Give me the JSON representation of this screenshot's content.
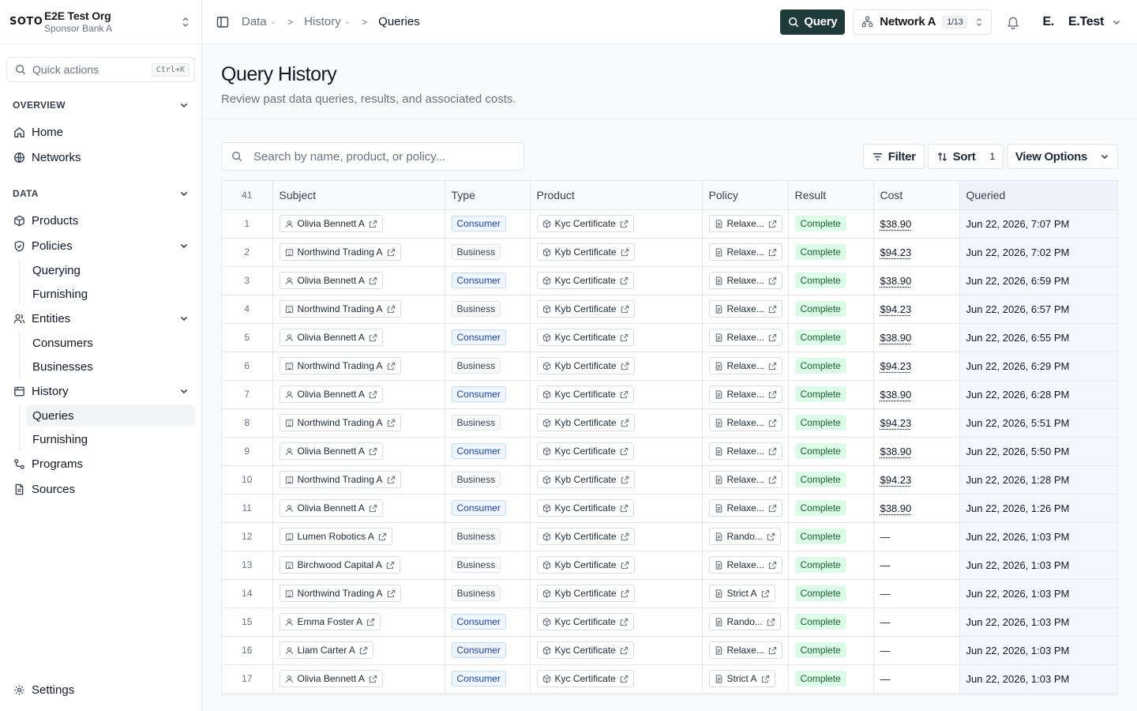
{
  "org": {
    "logo": "SOTO",
    "name": "E2E Test Org",
    "sub": "Sponsor Bank A"
  },
  "quick_actions": {
    "placeholder": "Quick actions",
    "shortcut": "Ctrl+K"
  },
  "sidebar": {
    "overview_label": "OVERVIEW",
    "home": "Home",
    "networks": "Networks",
    "data_label": "DATA",
    "products": "Products",
    "policies": "Policies",
    "policies_children": [
      "Querying",
      "Furnishing"
    ],
    "entities": "Entities",
    "entities_children": [
      "Consumers",
      "Businesses"
    ],
    "history": "History",
    "history_children": [
      "Queries",
      "Furnishing"
    ],
    "programs": "Programs",
    "sources": "Sources",
    "settings": "Settings"
  },
  "topbar": {
    "crumbs": [
      "Data",
      "History",
      "Queries"
    ],
    "query_button": "Query",
    "network": "Network A",
    "network_count": "1/13",
    "user_avatar": "E.",
    "user_name": "E.Test"
  },
  "page": {
    "title": "Query History",
    "subtitle": "Review past data queries, results, and associated costs."
  },
  "toolbar": {
    "search_placeholder": "Search by name, product, or policy...",
    "filter": "Filter",
    "sort": "Sort",
    "sort_count": "1",
    "view_options": "View Options"
  },
  "table": {
    "row_count": "41",
    "columns": [
      "Subject",
      "Type",
      "Product",
      "Policy",
      "Result",
      "Cost",
      "Queried"
    ],
    "rows": [
      {
        "n": "1",
        "subject": "Olivia Bennett A",
        "kind": "person",
        "type": "Consumer",
        "product": "Kyc Certificate",
        "policy": "Relaxe...",
        "result": "Complete",
        "cost": "$38.90",
        "queried": "Jun 22, 2026, 7:07 PM"
      },
      {
        "n": "2",
        "subject": "Northwind Trading A",
        "kind": "building",
        "type": "Business",
        "product": "Kyb Certificate",
        "policy": "Relaxe...",
        "result": "Complete",
        "cost": "$94.23",
        "queried": "Jun 22, 2026, 7:02 PM"
      },
      {
        "n": "3",
        "subject": "Olivia Bennett A",
        "kind": "person",
        "type": "Consumer",
        "product": "Kyc Certificate",
        "policy": "Relaxe...",
        "result": "Complete",
        "cost": "$38.90",
        "queried": "Jun 22, 2026, 6:59 PM"
      },
      {
        "n": "4",
        "subject": "Northwind Trading A",
        "kind": "building",
        "type": "Business",
        "product": "Kyb Certificate",
        "policy": "Relaxe...",
        "result": "Complete",
        "cost": "$94.23",
        "queried": "Jun 22, 2026, 6:57 PM"
      },
      {
        "n": "5",
        "subject": "Olivia Bennett A",
        "kind": "person",
        "type": "Consumer",
        "product": "Kyc Certificate",
        "policy": "Relaxe...",
        "result": "Complete",
        "cost": "$38.90",
        "queried": "Jun 22, 2026, 6:55 PM"
      },
      {
        "n": "6",
        "subject": "Northwind Trading A",
        "kind": "building",
        "type": "Business",
        "product": "Kyb Certificate",
        "policy": "Relaxe...",
        "result": "Complete",
        "cost": "$94.23",
        "queried": "Jun 22, 2026, 6:29 PM"
      },
      {
        "n": "7",
        "subject": "Olivia Bennett A",
        "kind": "person",
        "type": "Consumer",
        "product": "Kyc Certificate",
        "policy": "Relaxe...",
        "result": "Complete",
        "cost": "$38.90",
        "queried": "Jun 22, 2026, 6:28 PM"
      },
      {
        "n": "8",
        "subject": "Northwind Trading A",
        "kind": "building",
        "type": "Business",
        "product": "Kyb Certificate",
        "policy": "Relaxe...",
        "result": "Complete",
        "cost": "$94.23",
        "queried": "Jun 22, 2026, 5:51 PM"
      },
      {
        "n": "9",
        "subject": "Olivia Bennett A",
        "kind": "person",
        "type": "Consumer",
        "product": "Kyc Certificate",
        "policy": "Relaxe...",
        "result": "Complete",
        "cost": "$38.90",
        "queried": "Jun 22, 2026, 5:50 PM"
      },
      {
        "n": "10",
        "subject": "Northwind Trading A",
        "kind": "building",
        "type": "Business",
        "product": "Kyb Certificate",
        "policy": "Relaxe...",
        "result": "Complete",
        "cost": "$94.23",
        "queried": "Jun 22, 2026, 1:28 PM"
      },
      {
        "n": "11",
        "subject": "Olivia Bennett A",
        "kind": "person",
        "type": "Consumer",
        "product": "Kyc Certificate",
        "policy": "Relaxe...",
        "result": "Complete",
        "cost": "$38.90",
        "queried": "Jun 22, 2026, 1:26 PM"
      },
      {
        "n": "12",
        "subject": "Lumen Robotics A",
        "kind": "building",
        "type": "Business",
        "product": "Kyb Certificate",
        "policy": "Rando...",
        "result": "Complete",
        "cost": "—",
        "queried": "Jun 22, 2026, 1:03 PM"
      },
      {
        "n": "13",
        "subject": "Birchwood Capital A",
        "kind": "building",
        "type": "Business",
        "product": "Kyb Certificate",
        "policy": "Relaxe...",
        "result": "Complete",
        "cost": "—",
        "queried": "Jun 22, 2026, 1:03 PM"
      },
      {
        "n": "14",
        "subject": "Northwind Trading A",
        "kind": "building",
        "type": "Business",
        "product": "Kyb Certificate",
        "policy": "Strict A",
        "result": "Complete",
        "cost": "—",
        "queried": "Jun 22, 2026, 1:03 PM"
      },
      {
        "n": "15",
        "subject": "Emma Foster A",
        "kind": "person",
        "type": "Consumer",
        "product": "Kyc Certificate",
        "policy": "Rando...",
        "result": "Complete",
        "cost": "—",
        "queried": "Jun 22, 2026, 1:03 PM"
      },
      {
        "n": "16",
        "subject": "Liam Carter A",
        "kind": "person",
        "type": "Consumer",
        "product": "Kyc Certificate",
        "policy": "Relaxe...",
        "result": "Complete",
        "cost": "—",
        "queried": "Jun 22, 2026, 1:03 PM"
      },
      {
        "n": "17",
        "subject": "Olivia Bennett A",
        "kind": "person",
        "type": "Consumer",
        "product": "Kyc Certificate",
        "policy": "Strict A",
        "result": "Complete",
        "cost": "—",
        "queried": "Jun 22, 2026, 1:03 PM"
      }
    ]
  },
  "colors": {
    "query_button_bg": "#1f3a3a",
    "consumer_badge": "#1e40af",
    "complete_badge": "#166534",
    "queried_column_bg": "#f4f7fd"
  }
}
